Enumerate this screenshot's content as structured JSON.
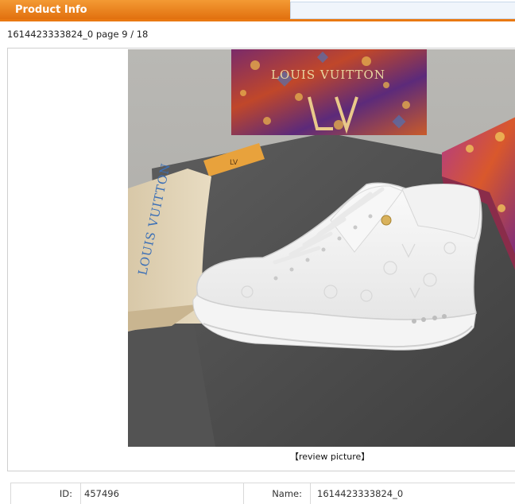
{
  "header": {
    "title": "Product Info"
  },
  "page_info": "1614423333824_0  page 9 / 18",
  "image": {
    "alt_text": "",
    "review_link": "【review picture】"
  },
  "details": {
    "id_label": "ID:",
    "id_value": "457496",
    "name_label": "Name:",
    "name_value": "1614423333824_0"
  },
  "photo_text": {
    "box_brand": "LOUIS VUITTON",
    "bag_brand": "LOUIS VUITTON"
  },
  "colors": {
    "header_orange": "#e97912",
    "frame_border": "#cfcfcf"
  }
}
